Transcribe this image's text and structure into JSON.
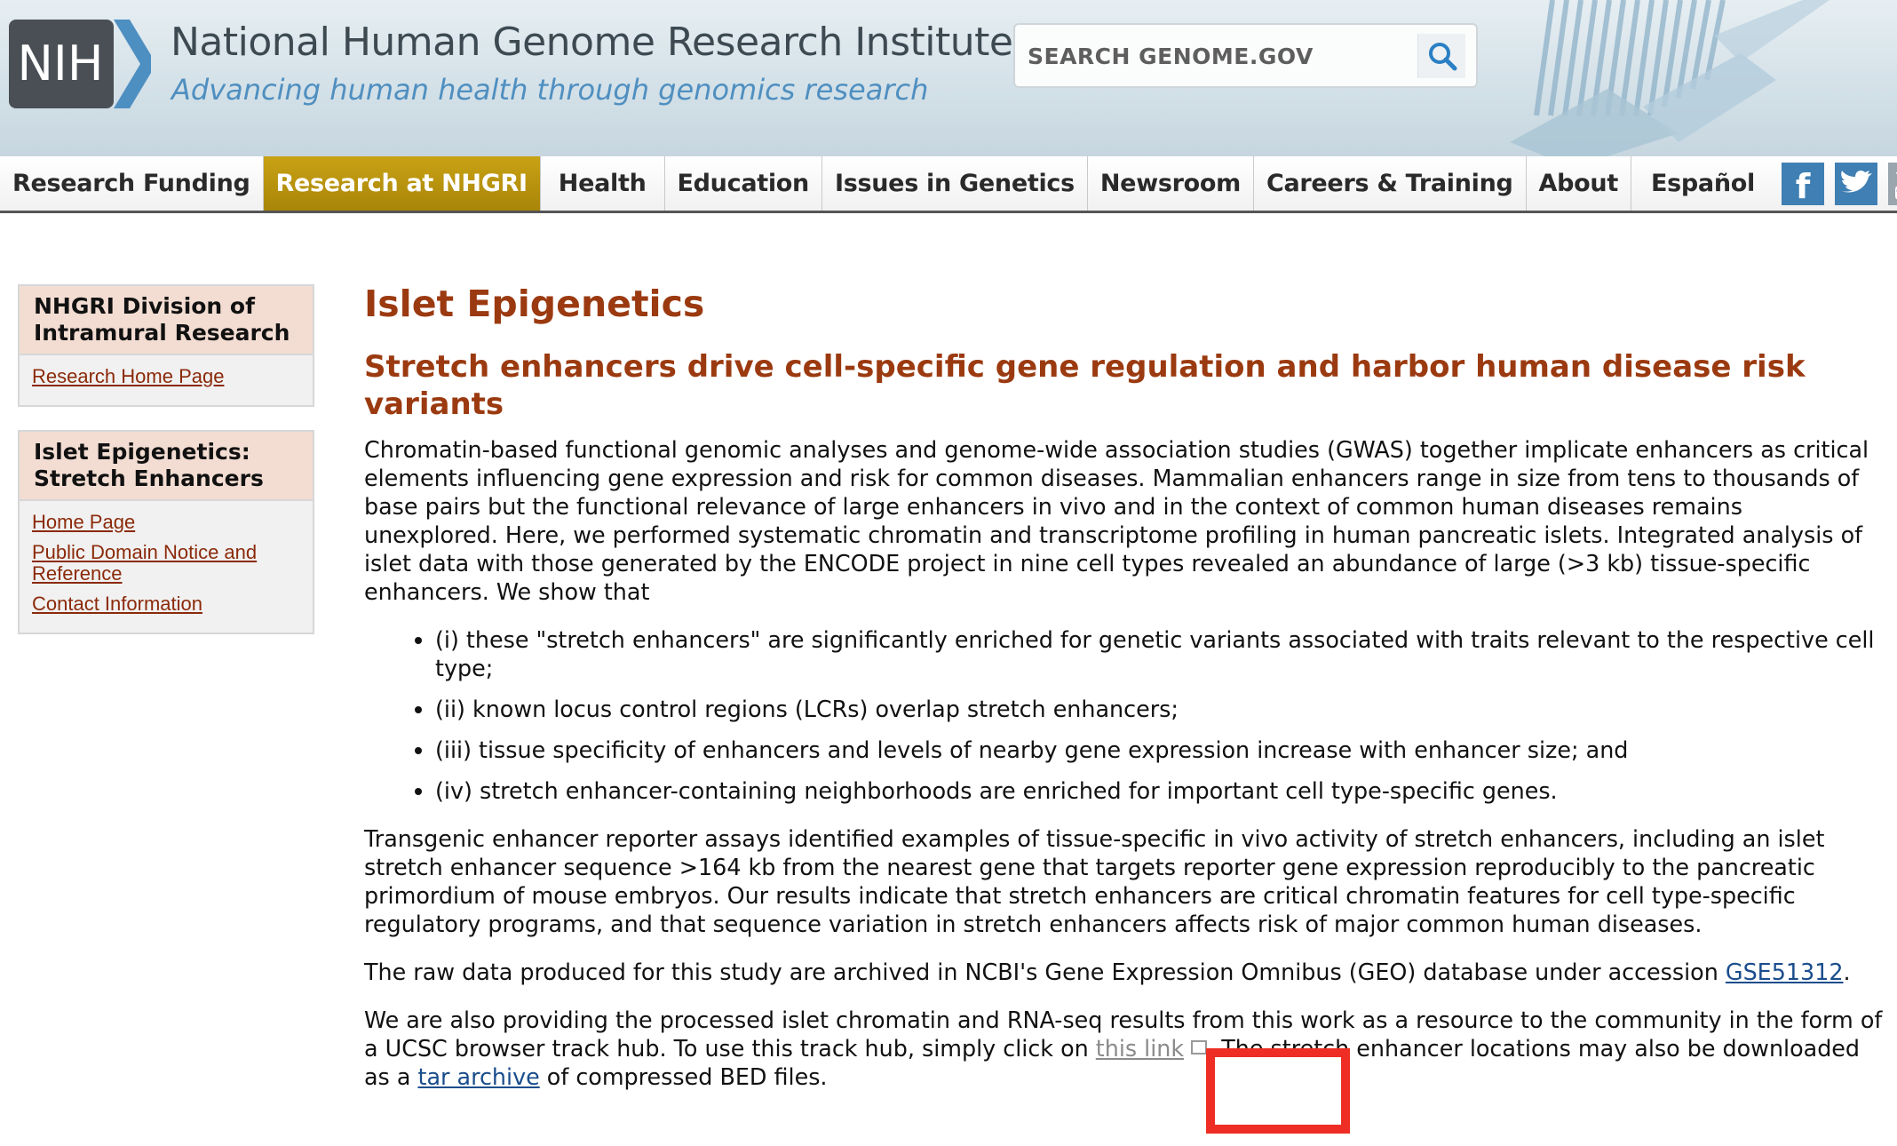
{
  "header": {
    "logo_text": "NIH",
    "title": "National Human Genome Research Institute",
    "tagline": "Advancing human health through genomics research",
    "search_placeholder": "SEARCH GENOME.GOV"
  },
  "nav": {
    "items": [
      {
        "label": "Research Funding",
        "active": false
      },
      {
        "label": "Research at NHGRI",
        "active": true
      },
      {
        "label": "Health",
        "active": false
      },
      {
        "label": "Education",
        "active": false
      },
      {
        "label": "Issues in Genetics",
        "active": false
      },
      {
        "label": "Newsroom",
        "active": false
      },
      {
        "label": "Careers & Training",
        "active": false
      },
      {
        "label": "About",
        "active": false
      },
      {
        "label": "Español",
        "active": false
      }
    ],
    "social": [
      "facebook-icon",
      "twitter-icon",
      "youtube-icon"
    ]
  },
  "sidebar": {
    "box1": {
      "heading": "NHGRI Division of Intramural Research",
      "links": [
        "Research Home Page"
      ]
    },
    "box2": {
      "heading": "Islet Epigenetics: Stretch Enhancers",
      "links": [
        "Home Page",
        "Public Domain Notice and Reference",
        "Contact Information"
      ]
    }
  },
  "main": {
    "title": "Islet Epigenetics",
    "subtitle": "Stretch enhancers drive cell-specific gene regulation and harbor human disease risk variants",
    "intro": "Chromatin-based functional genomic analyses and genome-wide association studies (GWAS) together implicate enhancers as critical elements influencing gene expression and risk for common diseases. Mammalian enhancers range in size from tens to thousands of base pairs but the functional relevance of large enhancers in vivo and in the context of common human diseases remains unexplored. Here, we performed systematic chromatin and transcriptome profiling in human pancreatic islets. Integrated analysis of islet data with those generated by the ENCODE project in nine cell types revealed an abundance of large (>3 kb) tissue-specific enhancers. We show that",
    "findings": [
      "(i) these \"stretch enhancers\" are significantly enriched for genetic variants associated with traits relevant to the respective cell type;",
      "(ii) known locus control regions (LCRs) overlap stretch enhancers;",
      "(iii) tissue specificity of enhancers and levels of nearby gene expression increase with enhancer size; and",
      "(iv) stretch enhancer-containing neighborhoods are enriched for important cell type-specific genes."
    ],
    "para2": "Transgenic enhancer reporter assays identified examples of tissue-specific in vivo activity of stretch enhancers, including an islet stretch enhancer sequence >164 kb from the nearest gene that targets reporter gene expression reproducibly to the pancreatic primordium of mouse embryos. Our results indicate that stretch enhancers are critical chromatin features for cell type-specific regulatory programs, and that sequence variation in stretch enhancers affects risk of major common human diseases.",
    "para3_before": "The raw data produced for this study are archived in NCBI's Gene Expression Omnibus (GEO) database under accession ",
    "para3_link": "GSE51312",
    "para3_after": ".",
    "para4_before": "We are also providing the processed islet chromatin and RNA-seq results from this work as a resource to the community in the form of a UCSC browser track hub. To use this track hub, simply click on ",
    "para4_link": "this link",
    "para4_middle": ". The stretch enhancer locations may also be downloaded as a ",
    "para4_link2": "tar archive",
    "para4_after": " of compressed BED files."
  },
  "colors": {
    "heading": "#9b3a10",
    "nav_active": "#c9a214",
    "link_sidebar": "#8b2a0a",
    "link_main": "#1a4d8c",
    "highlight": "#ee2e24"
  }
}
